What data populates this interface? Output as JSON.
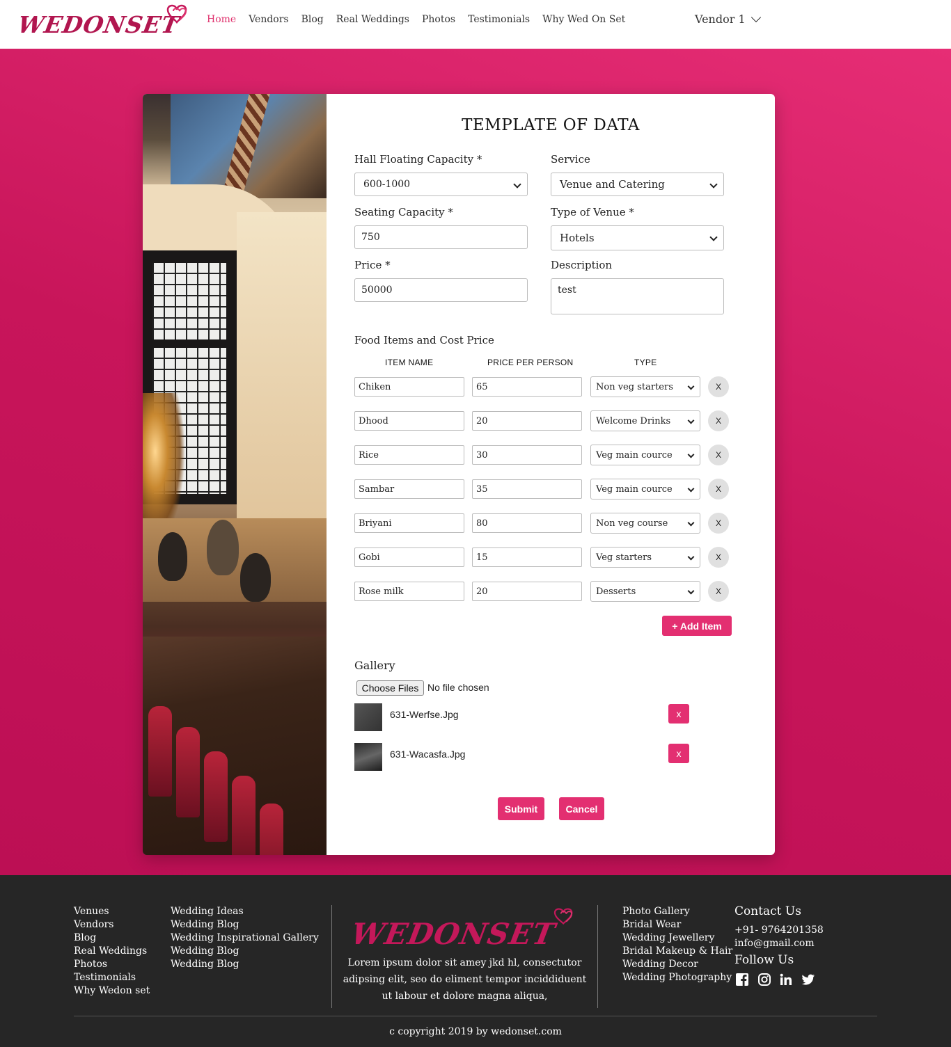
{
  "brand": {
    "logo_text": "WEDONSET",
    "accent": "#e32f71"
  },
  "nav": {
    "items": [
      "Home",
      "Vendors",
      "Blog",
      "Real Weddings",
      "Photos",
      "Testimonials",
      "Why Wed On Set"
    ],
    "active": "Home",
    "user_menu": "Vendor 1"
  },
  "form": {
    "title": "TEMPLATE OF DATA",
    "hall_capacity": {
      "label": "Hall Floating Capacity *",
      "value": "600-1000"
    },
    "service": {
      "label": "Service",
      "value": "Venue and Catering"
    },
    "seating_capacity": {
      "label": "Seating Capacity *",
      "value": "750"
    },
    "venue_type": {
      "label": "Type of Venue *",
      "value": "Hotels"
    },
    "price": {
      "label": "Price *",
      "value": "50000"
    },
    "description": {
      "label": "Description",
      "value": "test"
    },
    "food_title": "Food Items and Cost Price",
    "food_headers": {
      "name": "ITEM NAME",
      "price": "PRICE PER PERSON",
      "type": "TYPE"
    },
    "food_items": [
      {
        "name": "Chiken",
        "price": "65",
        "type": "Non veg starters",
        "remove": "X"
      },
      {
        "name": "Dhood",
        "price": "20",
        "type": "Welcome Drinks",
        "remove": "X"
      },
      {
        "name": "Rice",
        "price": "30",
        "type": "Veg main cource",
        "remove": "X"
      },
      {
        "name": "Sambar",
        "price": "35",
        "type": "Veg main cource",
        "remove": "X"
      },
      {
        "name": "Briyani",
        "price": "80",
        "type": "Non veg course",
        "remove": "X"
      },
      {
        "name": "Gobi",
        "price": "15",
        "type": "Veg starters",
        "remove": "X"
      },
      {
        "name": "Rose milk",
        "price": "20",
        "type": "Desserts",
        "remove": "X"
      }
    ],
    "add_item": "+ Add Item",
    "gallery": {
      "label": "Gallery",
      "choose": "Choose Files",
      "status": "No file chosen",
      "files": [
        {
          "name": "631-Werfse.Jpg",
          "remove": "x"
        },
        {
          "name": "631-Wacasfa.Jpg",
          "remove": "x"
        }
      ]
    },
    "submit": "Submit",
    "cancel": "Cancel"
  },
  "footer": {
    "col1": [
      "Venues",
      "Vendors",
      "Blog",
      "Real Weddings",
      "Photos",
      "Testimonials",
      "Why Wedon set"
    ],
    "col2": [
      "Wedding Ideas",
      "Wedding Blog",
      "Wedding Inspirational Gallery",
      "Wedding Blog",
      "Wedding Blog"
    ],
    "description": "Lorem ipsum dolor sit amey jkd hl, consectutor adipsing elit, seo do eliment tempor inciddiduent ut labour et dolore magna aliqua,",
    "col3": [
      "Photo Gallery",
      "Bridal Wear",
      "Wedding Jewellery",
      "Bridal Makeup & Hair",
      "Wedding Decor",
      "Wedding Photography"
    ],
    "contact_title": "Contact Us",
    "phone": "+91- 9764201358",
    "email": "info@gmail.com",
    "follow_title": "Follow Us",
    "social_icons": [
      "facebook-icon",
      "instagram-icon",
      "linkedin-icon",
      "twitter-icon"
    ],
    "copyright": "c copyright 2019 by wedonset.com"
  }
}
